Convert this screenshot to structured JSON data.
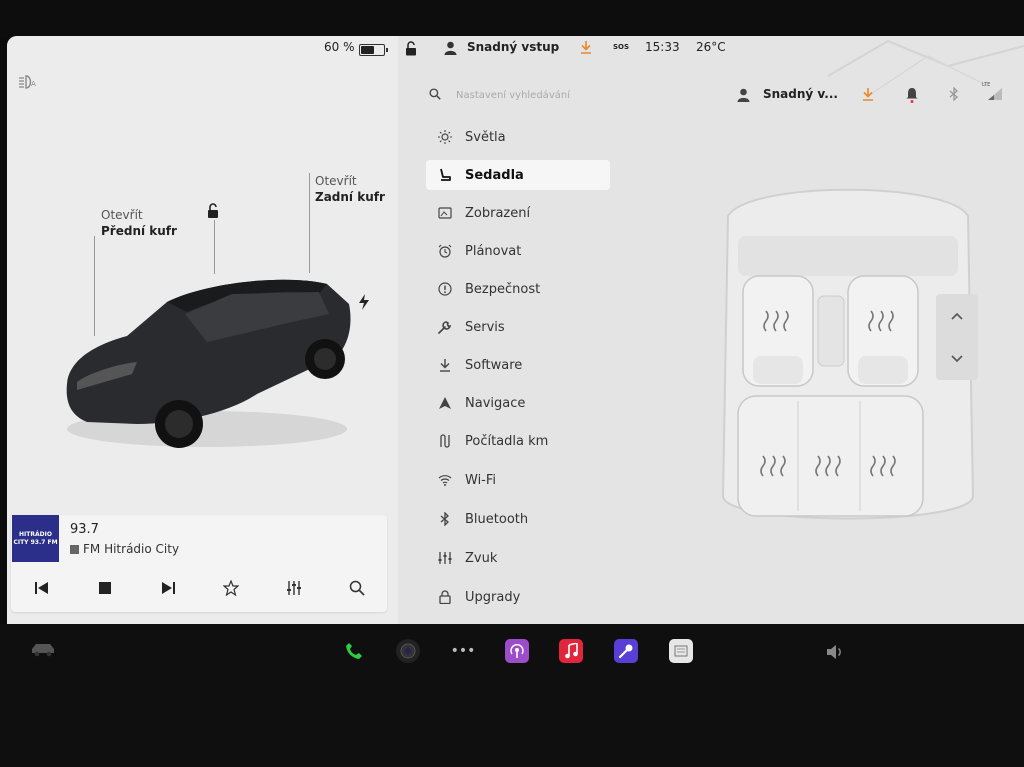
{
  "status": {
    "battery_percent": "60 %",
    "battery_level": 0.6,
    "profile_name": "Snadný vstup",
    "sos": "SOS",
    "time": "15:33",
    "temperature": "26°C"
  },
  "car_panel": {
    "front_trunk": {
      "action": "Otevřít",
      "label": "Přední kufr"
    },
    "rear_trunk": {
      "action": "Otevřít",
      "label": "Zadní kufr"
    }
  },
  "media": {
    "logo_text": "HITRÁDIO CITY 93.7 FM",
    "frequency": "93.7",
    "station": "FM Hitrádio City"
  },
  "settings": {
    "search_placeholder": "Nastavení vyhledávání",
    "profile_short": "Snadný v...",
    "lte": "LTE",
    "menu": [
      {
        "label": "Světla",
        "icon": "sun-icon"
      },
      {
        "label": "Sedadla",
        "icon": "seat-icon",
        "active": true
      },
      {
        "label": "Zobrazení",
        "icon": "display-icon"
      },
      {
        "label": "Plánovat",
        "icon": "alarm-clock-icon"
      },
      {
        "label": "Bezpečnost",
        "icon": "alert-icon"
      },
      {
        "label": "Servis",
        "icon": "wrench-icon"
      },
      {
        "label": "Software",
        "icon": "download-icon"
      },
      {
        "label": "Navigace",
        "icon": "navigation-icon"
      },
      {
        "label": "Počítadla km",
        "icon": "trip-icon"
      },
      {
        "label": "Wi-Fi",
        "icon": "wifi-icon"
      },
      {
        "label": "Bluetooth",
        "icon": "bluetooth-icon"
      },
      {
        "label": "Zvuk",
        "icon": "equalizer-icon"
      },
      {
        "label": "Upgrady",
        "icon": "lock-icon"
      }
    ]
  },
  "colors": {
    "accent_orange": "#e8892b",
    "active_bg": "#f6f6f6",
    "phone_green": "#2ecc40",
    "podcast_purple": "#9b4dca",
    "music_red": "#e0263c",
    "karaoke_purple": "#5a3fd6"
  }
}
